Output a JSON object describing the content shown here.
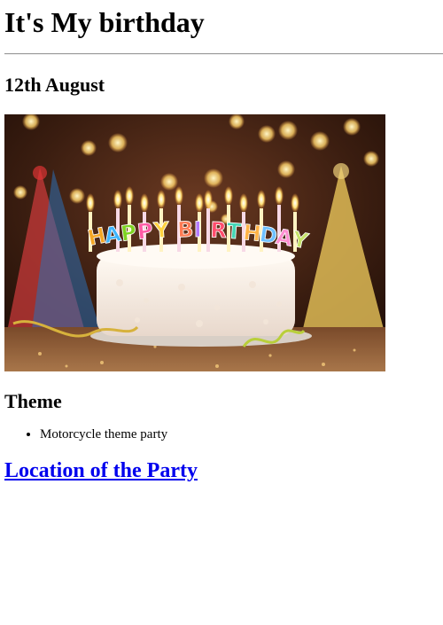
{
  "page": {
    "title": "It's My birthday",
    "date": "12th August",
    "image": {
      "cake_text": "HAPPY BIRTHDAY",
      "letters": [
        "H",
        "A",
        "P",
        "P",
        "Y",
        "B",
        "I",
        "R",
        "T",
        "H",
        "D",
        "A",
        "Y"
      ],
      "letter_colors": [
        "#f5a623",
        "#3fb6ff",
        "#7ed321",
        "#ff5aa5",
        "#ffd23f",
        "#ff7b54",
        "#b57bff",
        "#ff4d6d",
        "#44d7b6",
        "#ffb347",
        "#6ec1ff",
        "#ff8fd1",
        "#c7e36b"
      ]
    },
    "theme_heading": "Theme",
    "theme_items": [
      "Motorcycle theme party"
    ],
    "location_link": "Location of the Party"
  }
}
